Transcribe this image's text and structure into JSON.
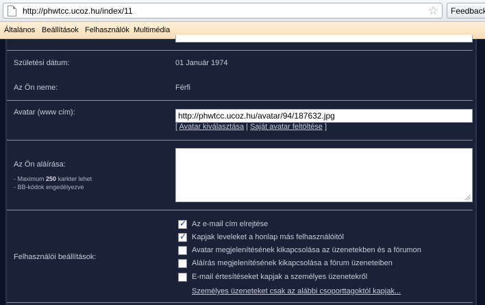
{
  "browser": {
    "url": "http://phwtcc.ucoz.hu/index/11",
    "feedback_label": "Feedback"
  },
  "site_menu": {
    "items": [
      "Általános",
      "Beállítások",
      "Felhasználók",
      "Multimédia"
    ]
  },
  "form": {
    "birth_date": {
      "label": "Születési dátum:",
      "value": "01 Január 1974"
    },
    "gender": {
      "label": "Az Ön neme:",
      "value": "Férfi"
    },
    "avatar": {
      "label": "Avatar (www cím):",
      "value": "http://phwtcc.ucoz.hu/avatar/94/187632.jpg",
      "link_open": "[",
      "choose_link": "Avatar kiválasztása",
      "separator": "|",
      "upload_link": "Saját avatar feltöltése",
      "link_close": "]"
    },
    "signature": {
      "label": "Az Ön aláírása:",
      "hint_prefix": "- Maximum",
      "hint_max": "250",
      "hint_suffix": "karkter lehet",
      "hint_bbcode": "- BB-kódok engedélyezve",
      "value": ""
    },
    "user_settings": {
      "label": "Felhasználói beállítások:",
      "options": [
        {
          "label": "Az e-mail cím elrejtése",
          "checked": true
        },
        {
          "label": "Kapjak leveleket a honlap más felhasználóitól",
          "checked": true
        },
        {
          "label": "Avatar megjelenítésének kikapcsolása az üzenetekben és a fórumon",
          "checked": false
        },
        {
          "label": "Aláírás megjelenítésének kikapcsolása a fórum üzeneteiben",
          "checked": false
        },
        {
          "label": "E-mail értesítéseket kapjak a személyes üzenetekről",
          "checked": false
        }
      ],
      "group_link": "Személyes üzeneteket csak az alábbi csoporttagoktól kapjak..."
    }
  },
  "colors": {
    "page_bg": "#0d1326",
    "panel_bg": "#1b2238",
    "text": "#c7cbd8",
    "menubar": "#f6dfb4"
  }
}
